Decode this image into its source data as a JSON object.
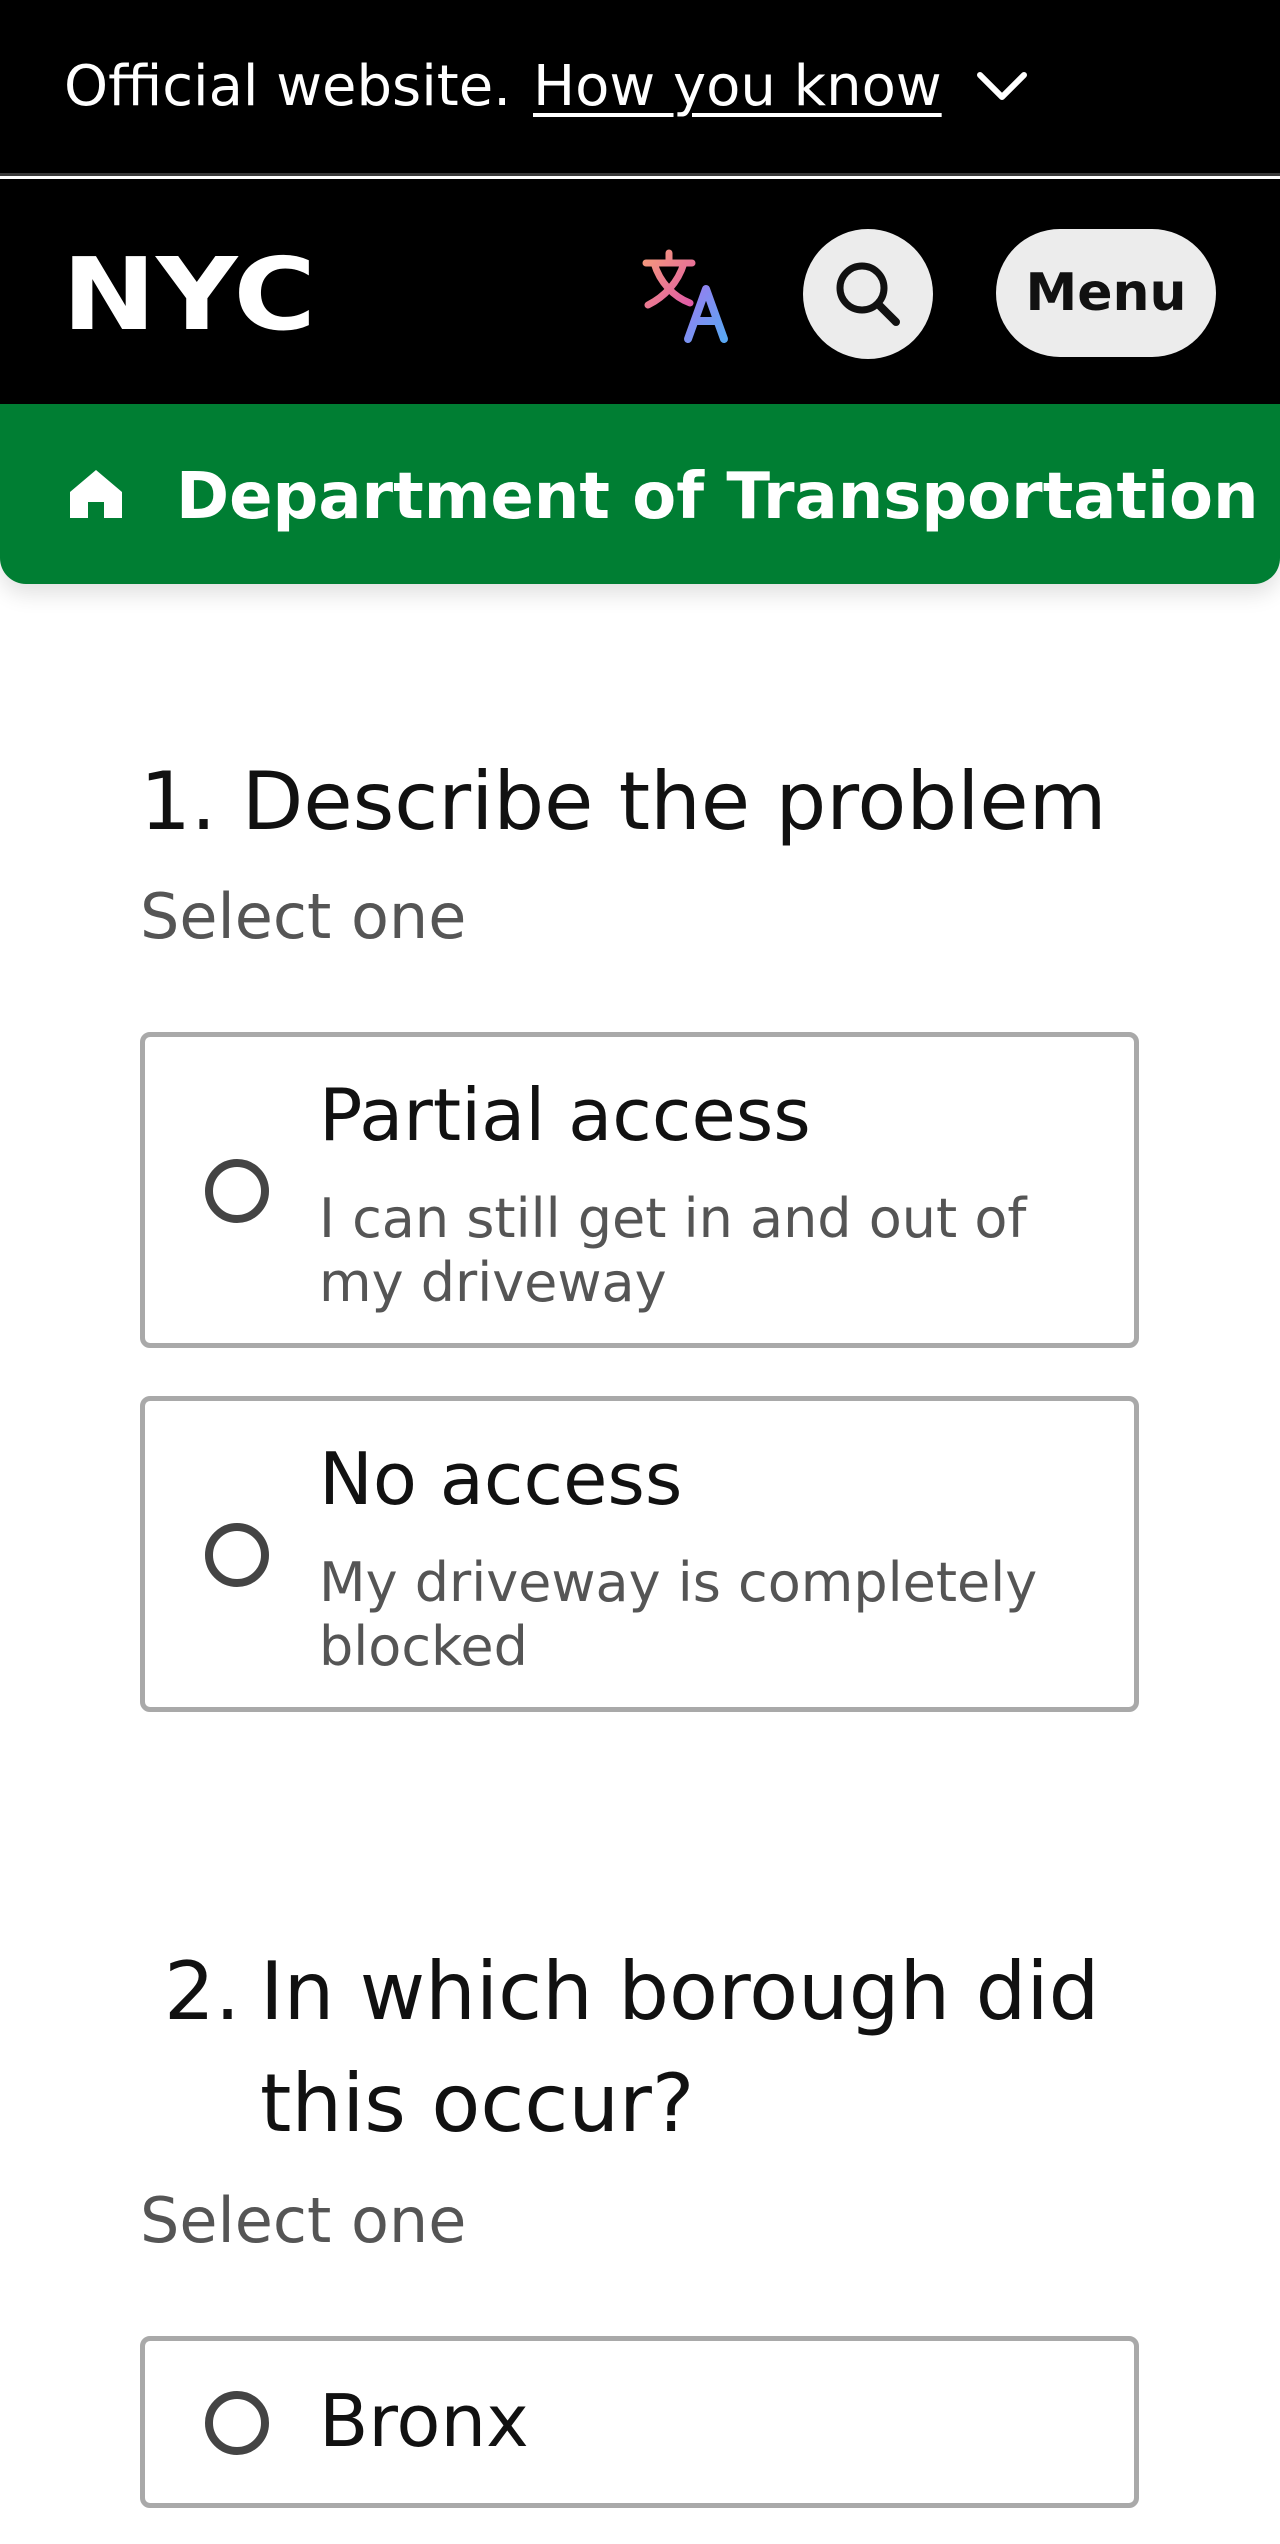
{
  "official_banner": {
    "text": "Official website.",
    "link": "How you know"
  },
  "header": {
    "logo_text": "NYC",
    "menu_label": "Menu"
  },
  "department": {
    "title": "Department of Transportation"
  },
  "question1": {
    "title": "1. Describe the problem",
    "hint": "Select one",
    "options": [
      {
        "label": "Partial access",
        "description": "I can still get in and out of my driveway"
      },
      {
        "label": "No access",
        "description": "My driveway is completely blocked"
      }
    ]
  },
  "question2": {
    "number": "2.",
    "title": "In which borough did this occur?",
    "hint": "Select one",
    "options": [
      {
        "label": "Bronx"
      }
    ]
  },
  "colors": {
    "banner_bg": "#000000",
    "department_green": "#007e33",
    "button_grey": "#ececec",
    "border_grey": "#a9a9a9"
  }
}
